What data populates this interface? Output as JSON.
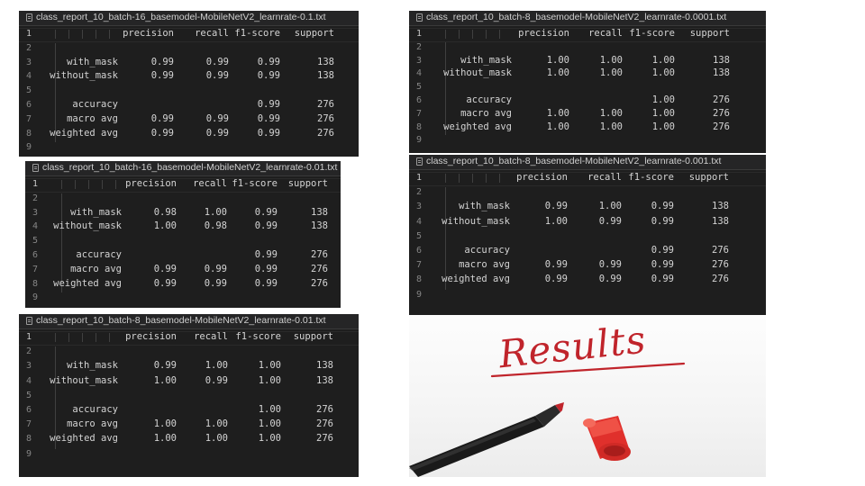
{
  "columns": [
    "precision",
    "recall",
    "f1-score",
    "support"
  ],
  "line_numbers": [
    "1",
    "2",
    "3",
    "4",
    "5",
    "6",
    "7",
    "8",
    "9"
  ],
  "panels": [
    {
      "filename": "class_report_10_batch-16_basemodel-MobileNetV2_learnrate-0.1.txt",
      "rows": [
        {
          "label": "with_mask",
          "precision": "0.99",
          "recall": "0.99",
          "f1": "0.99",
          "support": "138"
        },
        {
          "label": "without_mask",
          "precision": "0.99",
          "recall": "0.99",
          "f1": "0.99",
          "support": "138"
        },
        {
          "label": "accuracy",
          "precision": "",
          "recall": "",
          "f1": "0.99",
          "support": "276"
        },
        {
          "label": "macro avg",
          "precision": "0.99",
          "recall": "0.99",
          "f1": "0.99",
          "support": "276"
        },
        {
          "label": "weighted avg",
          "precision": "0.99",
          "recall": "0.99",
          "f1": "0.99",
          "support": "276"
        }
      ]
    },
    {
      "filename": "class_report_10_batch-16_basemodel-MobileNetV2_learnrate-0.01.txt",
      "rows": [
        {
          "label": "with_mask",
          "precision": "0.98",
          "recall": "1.00",
          "f1": "0.99",
          "support": "138"
        },
        {
          "label": "without_mask",
          "precision": "1.00",
          "recall": "0.98",
          "f1": "0.99",
          "support": "138"
        },
        {
          "label": "accuracy",
          "precision": "",
          "recall": "",
          "f1": "0.99",
          "support": "276"
        },
        {
          "label": "macro avg",
          "precision": "0.99",
          "recall": "0.99",
          "f1": "0.99",
          "support": "276"
        },
        {
          "label": "weighted avg",
          "precision": "0.99",
          "recall": "0.99",
          "f1": "0.99",
          "support": "276"
        }
      ]
    },
    {
      "filename": "class_report_10_batch-8_basemodel-MobileNetV2_learnrate-0.01.txt",
      "rows": [
        {
          "label": "with_mask",
          "precision": "0.99",
          "recall": "1.00",
          "f1": "1.00",
          "support": "138"
        },
        {
          "label": "without_mask",
          "precision": "1.00",
          "recall": "0.99",
          "f1": "1.00",
          "support": "138"
        },
        {
          "label": "accuracy",
          "precision": "",
          "recall": "",
          "f1": "1.00",
          "support": "276"
        },
        {
          "label": "macro avg",
          "precision": "1.00",
          "recall": "1.00",
          "f1": "1.00",
          "support": "276"
        },
        {
          "label": "weighted avg",
          "precision": "1.00",
          "recall": "1.00",
          "f1": "1.00",
          "support": "276"
        }
      ]
    },
    {
      "filename": "class_report_10_batch-8_basemodel-MobileNetV2_learnrate-0.0001.txt",
      "rows": [
        {
          "label": "with_mask",
          "precision": "1.00",
          "recall": "1.00",
          "f1": "1.00",
          "support": "138"
        },
        {
          "label": "without_mask",
          "precision": "1.00",
          "recall": "1.00",
          "f1": "1.00",
          "support": "138"
        },
        {
          "label": "accuracy",
          "precision": "",
          "recall": "",
          "f1": "1.00",
          "support": "276"
        },
        {
          "label": "macro avg",
          "precision": "1.00",
          "recall": "1.00",
          "f1": "1.00",
          "support": "276"
        },
        {
          "label": "weighted avg",
          "precision": "1.00",
          "recall": "1.00",
          "f1": "1.00",
          "support": "276"
        }
      ]
    },
    {
      "filename": "class_report_10_batch-8_basemodel-MobileNetV2_learnrate-0.001.txt",
      "rows": [
        {
          "label": "with_mask",
          "precision": "0.99",
          "recall": "1.00",
          "f1": "0.99",
          "support": "138"
        },
        {
          "label": "without_mask",
          "precision": "1.00",
          "recall": "0.99",
          "f1": "0.99",
          "support": "138"
        },
        {
          "label": "accuracy",
          "precision": "",
          "recall": "",
          "f1": "0.99",
          "support": "276"
        },
        {
          "label": "macro avg",
          "precision": "0.99",
          "recall": "0.99",
          "f1": "0.99",
          "support": "276"
        },
        {
          "label": "weighted avg",
          "precision": "0.99",
          "recall": "0.99",
          "f1": "0.99",
          "support": "276"
        }
      ]
    }
  ],
  "photo": {
    "word": "Results",
    "ink_color": "#c0242b",
    "icon_pen": "marker-pen",
    "icon_cap": "marker-cap"
  },
  "colors": {
    "editor_bg": "#1e1e1e",
    "text": "#d4d4d4",
    "line_number": "#858585"
  }
}
